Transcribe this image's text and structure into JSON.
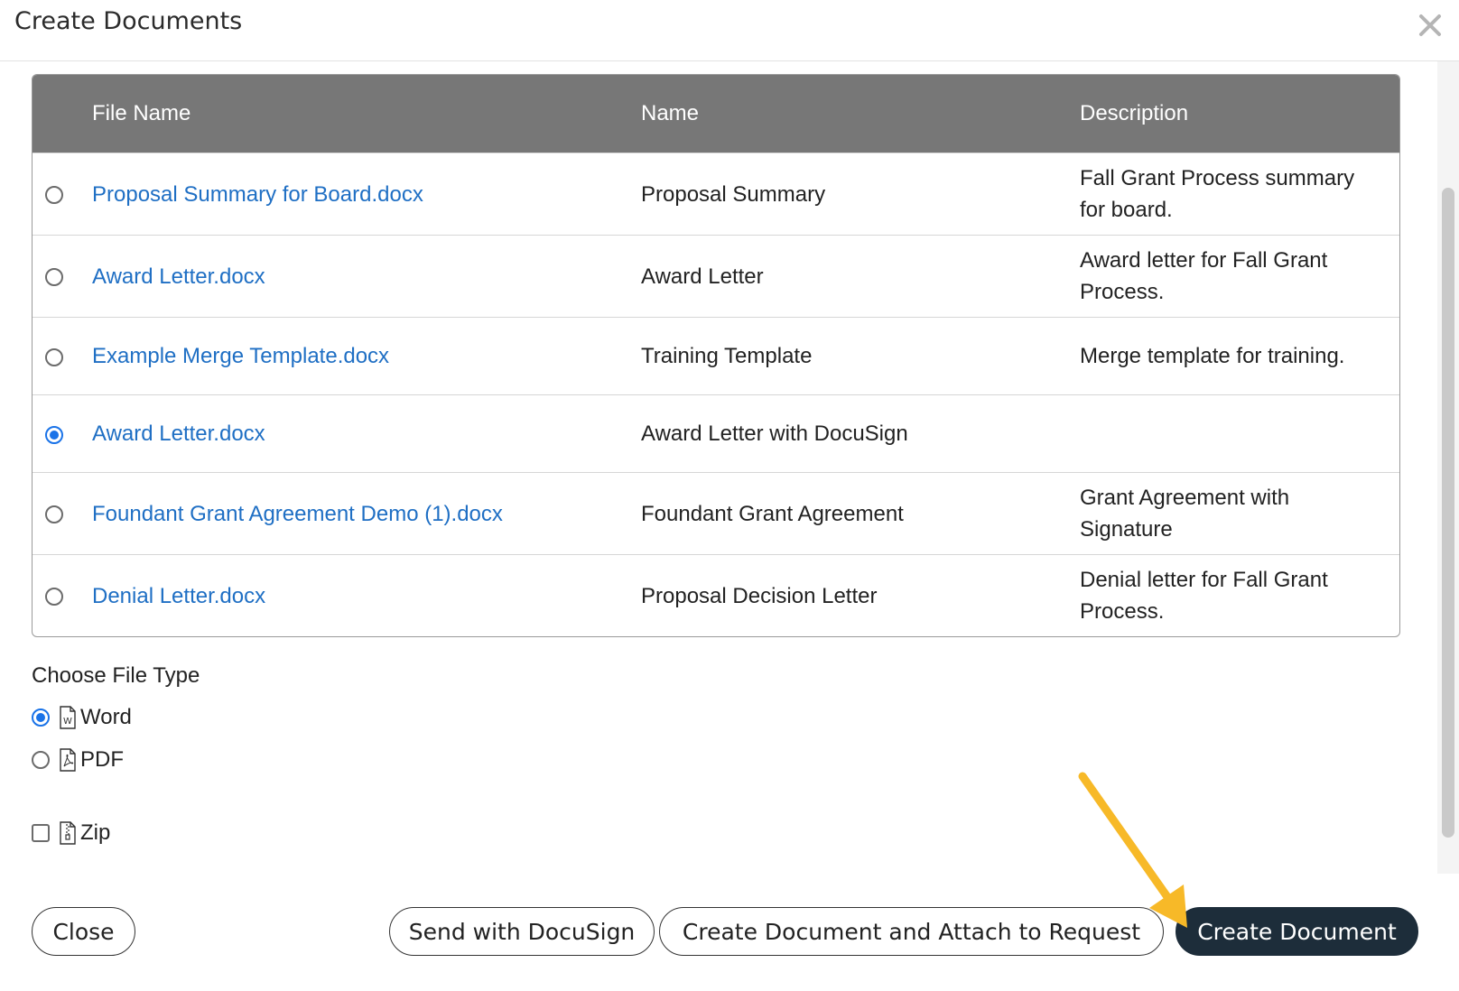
{
  "dialog": {
    "title": "Create Documents"
  },
  "table": {
    "headers": [
      "File Name",
      "Name",
      "Description"
    ],
    "rows": [
      {
        "file": "Proposal Summary for Board.docx",
        "name": "Proposal Summary",
        "description": "Fall Grant Process summary for board.",
        "selected": false
      },
      {
        "file": "Award Letter.docx",
        "name": "Award Letter",
        "description": "Award letter for Fall Grant Process.",
        "selected": false
      },
      {
        "file": "Example Merge Template.docx",
        "name": "Training Template",
        "description": "Merge template for training.",
        "selected": false
      },
      {
        "file": "Award Letter.docx",
        "name": "Award Letter with DocuSign",
        "description": "",
        "selected": true
      },
      {
        "file": "Foundant Grant Agreement Demo (1).docx",
        "name": "Foundant Grant Agreement",
        "description": "Grant Agreement with Signature",
        "selected": false
      },
      {
        "file": "Denial Letter.docx",
        "name": "Proposal Decision Letter",
        "description": "Denial letter for Fall Grant Process.",
        "selected": false
      }
    ]
  },
  "file_type": {
    "label": "Choose File Type",
    "word": "Word",
    "pdf": "PDF",
    "zip": "Zip",
    "selected": "Word",
    "zip_checked": false
  },
  "buttons": {
    "close": "Close",
    "docusign": "Send with DocuSign",
    "attach": "Create Document and Attach to Request",
    "create": "Create Document"
  },
  "colors": {
    "link": "#1f6fc4",
    "primary_button": "#1d2d3a",
    "header": "#777777",
    "arrow": "#f7b928"
  }
}
